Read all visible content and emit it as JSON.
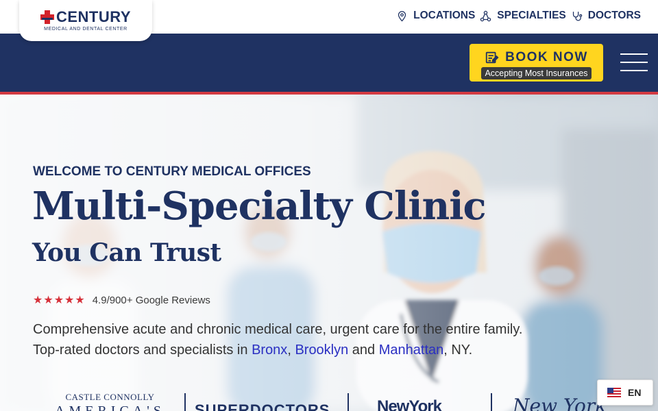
{
  "brand": {
    "name": "CENTURY",
    "tagline": "MEDICAL AND DENTAL CENTER"
  },
  "topnav": {
    "items": [
      {
        "label": "LOCATIONS",
        "icon": "map-pin-icon"
      },
      {
        "label": "SPECIALTIES",
        "icon": "network-icon"
      },
      {
        "label": "DOCTORS",
        "icon": "stethoscope-icon"
      }
    ]
  },
  "cta": {
    "label": "BOOK NOW",
    "sublabel": "Accepting Most Insurances",
    "icon": "calendar-edit-icon",
    "color": "#ffd51f"
  },
  "hero": {
    "welcome": "WELCOME TO CENTURY MEDICAL OFFICES",
    "headline": "Multi-Specialty Clinic",
    "subheadline": "You Can Trust",
    "stars": "★★★★★",
    "rating_text": "4.9/900+ Google Reviews",
    "desc_line1": "Comprehensive acute and chronic medical care, urgent care for the entire family.",
    "desc_line2_prefix": "Top-rated doctors and specialists in ",
    "loc_bronx": "Bronx",
    "sep1": ", ",
    "loc_brooklyn": "Brooklyn",
    "sep2": " and ",
    "loc_manhattan": "Manhattan",
    "desc_line2_suffix": ", NY."
  },
  "awards": {
    "castle_line1": "CASTLE CONNOLLY",
    "castle_line2": "AMERICA'S",
    "superdoctors": "SUPERDOCTORS",
    "nymag": "NewYork",
    "nymag2": "New York"
  },
  "language": {
    "label": "EN"
  },
  "colors": {
    "navy": "#1f3262",
    "red": "#d33a42",
    "link": "#2a2fc2"
  }
}
